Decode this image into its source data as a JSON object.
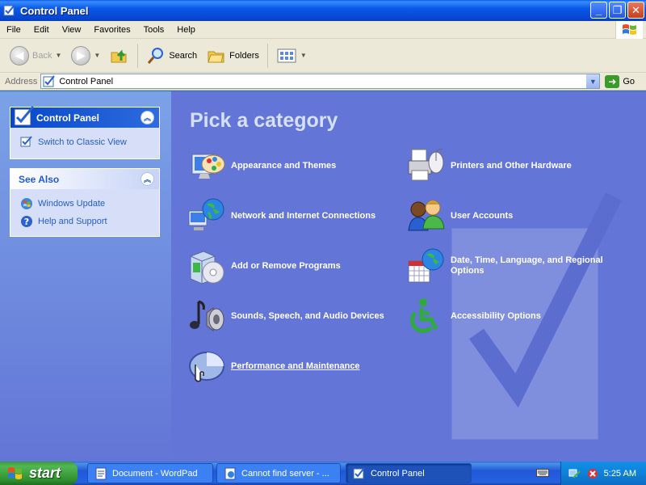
{
  "window": {
    "title": "Control Panel"
  },
  "menu": [
    "File",
    "Edit",
    "View",
    "Favorites",
    "Tools",
    "Help"
  ],
  "toolbar": {
    "back": "Back",
    "search": "Search",
    "folders": "Folders"
  },
  "address": {
    "label": "Address",
    "value": "Control Panel",
    "go": "Go"
  },
  "sidebar": {
    "control_panel": {
      "title": "Control Panel",
      "links": [
        "Switch to Classic View"
      ]
    },
    "see_also": {
      "title": "See Also",
      "links": [
        "Windows Update",
        "Help and Support"
      ]
    }
  },
  "main": {
    "heading": "Pick a category",
    "categories": [
      "Appearance and Themes",
      "Printers and Other Hardware",
      "Network and Internet Connections",
      "User Accounts",
      "Add or Remove Programs",
      "Date, Time, Language, and Regional Options",
      "Sounds, Speech, and Audio Devices",
      "Accessibility Options",
      "Performance and Maintenance"
    ]
  },
  "taskbar": {
    "start": "start",
    "items": [
      "Document - WordPad",
      "Cannot find server - ...",
      "Control Panel"
    ],
    "clock": "5:25 AM"
  },
  "colors": {
    "title_blue": "#0a58e8",
    "main_bg": "#6375d6",
    "link_blue": "#215dc6",
    "start_green": "#3c9b3c"
  }
}
